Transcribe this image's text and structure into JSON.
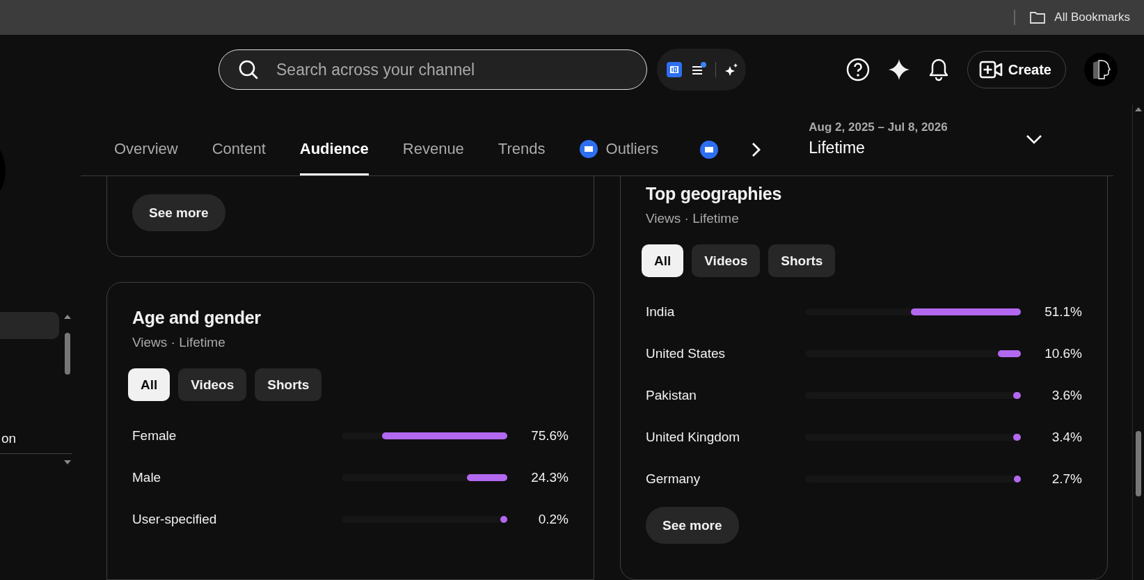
{
  "browser_bar": {
    "bookmarks_label": "All Bookmarks"
  },
  "header": {
    "search": {
      "placeholder": "Search across your channel"
    },
    "create_button": "Create"
  },
  "sidebar": {
    "items": [
      {
        "label": "on"
      }
    ]
  },
  "tabs": [
    {
      "label": "Overview",
      "selected": false,
      "iq_badge": false
    },
    {
      "label": "Content",
      "selected": false,
      "iq_badge": false
    },
    {
      "label": "Audience",
      "selected": true,
      "iq_badge": false
    },
    {
      "label": "Revenue",
      "selected": false,
      "iq_badge": false
    },
    {
      "label": "Trends",
      "selected": false,
      "iq_badge": false
    },
    {
      "label": "Outliers",
      "selected": false,
      "iq_badge": true
    }
  ],
  "date_range": {
    "range": "Aug 2, 2025 – Jul 8, 2026",
    "period": "Lifetime"
  },
  "top_card": {
    "see_more": "See more"
  },
  "age_gender": {
    "title": "Age and gender",
    "subtitle": "Views · Lifetime",
    "filters": [
      {
        "label": "All",
        "selected": true
      },
      {
        "label": "Videos",
        "selected": false
      },
      {
        "label": "Shorts",
        "selected": false
      }
    ],
    "rows": [
      {
        "label": "Female",
        "level": 0.756,
        "value": "75.6%"
      },
      {
        "label": "Male",
        "level": 0.243,
        "value": "24.3%"
      },
      {
        "label": "User-specified",
        "level": 0.002,
        "value": "0.2%"
      }
    ]
  },
  "top_geographies": {
    "title": "Top geographies",
    "subtitle": "Views · Lifetime",
    "filters": [
      {
        "label": "All",
        "selected": true
      },
      {
        "label": "Videos",
        "selected": false
      },
      {
        "label": "Shorts",
        "selected": false
      }
    ],
    "rows": [
      {
        "label": "India",
        "level": 0.511,
        "value": "51.1%"
      },
      {
        "label": "United States",
        "level": 0.106,
        "value": "10.6%"
      },
      {
        "label": "Pakistan",
        "level": 0.036,
        "value": "3.6%"
      },
      {
        "label": "United Kingdom",
        "level": 0.034,
        "value": "3.4%"
      },
      {
        "label": "Germany",
        "level": 0.027,
        "value": "2.7%"
      }
    ],
    "see_more": "See more"
  }
}
